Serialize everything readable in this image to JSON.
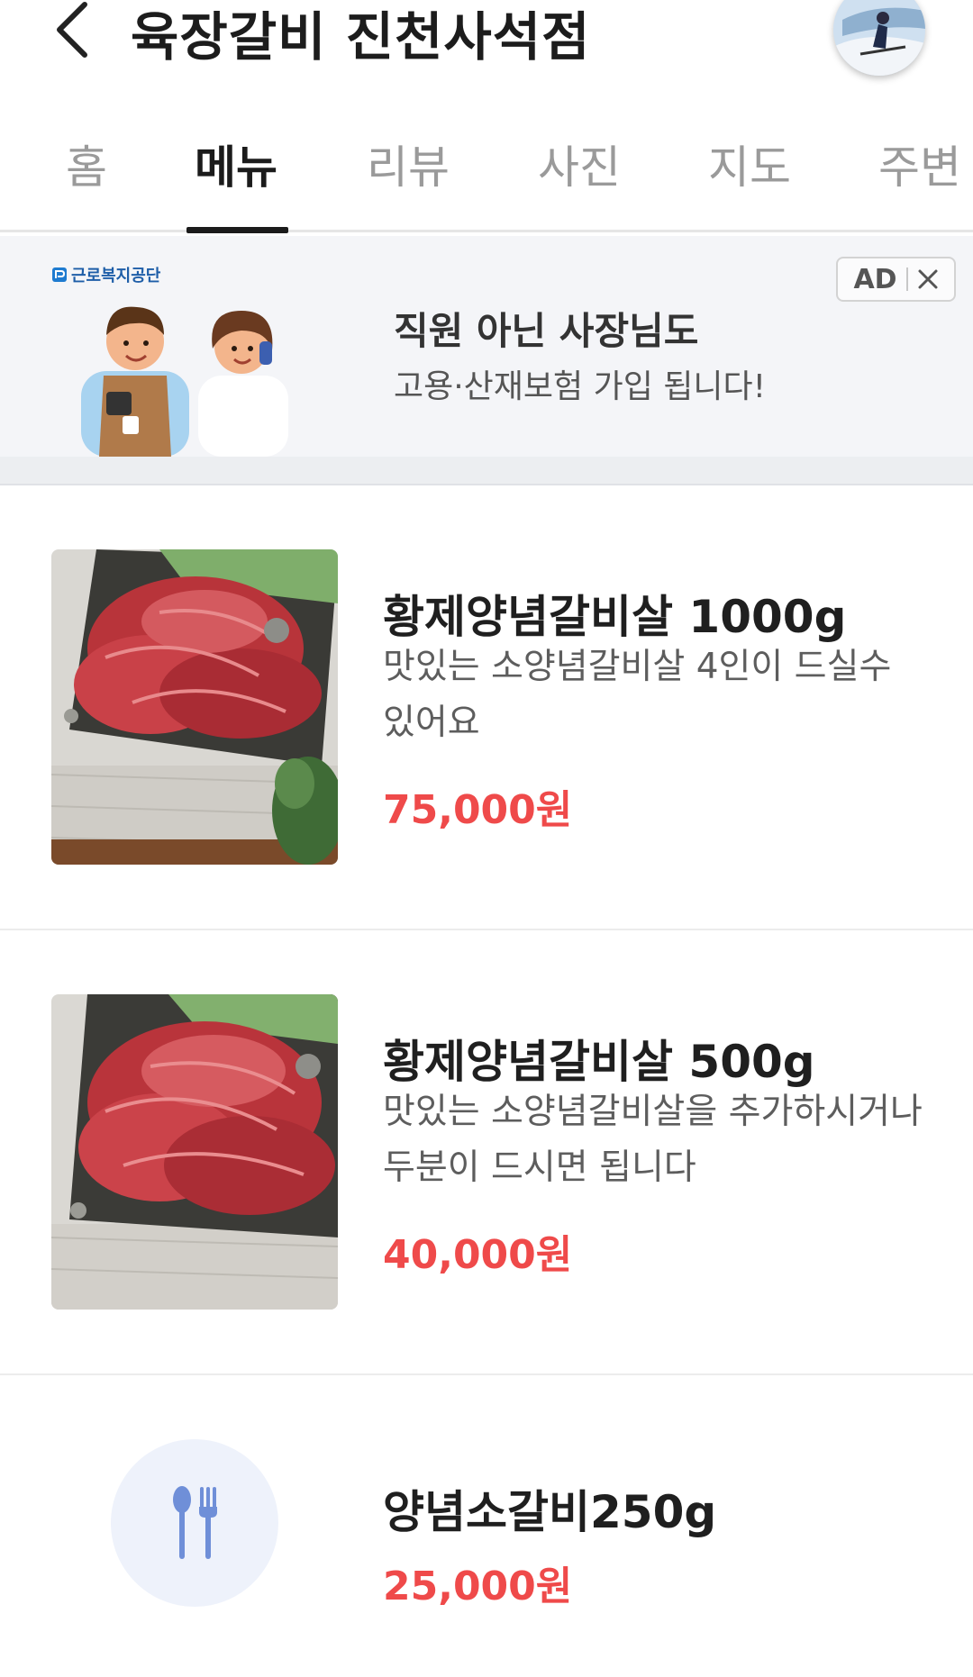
{
  "header": {
    "title": "육장갈비 진천사석점"
  },
  "tabs": [
    {
      "label": "홈",
      "active": false
    },
    {
      "label": "메뉴",
      "active": true
    },
    {
      "label": "리뷰",
      "active": false
    },
    {
      "label": "사진",
      "active": false
    },
    {
      "label": "지도",
      "active": false
    },
    {
      "label": "주변",
      "active": false
    }
  ],
  "ad": {
    "brand": "근로복지공단",
    "title": "직원 아닌 사장님도",
    "subtitle": "고용·산재보험 가입 됩니다!",
    "badge": "AD"
  },
  "menu": [
    {
      "name": "황제양념갈비살 1000g",
      "description": "맛있는 소양념갈비살 4인이 드실수 있어요",
      "price": "75,000원",
      "image": "marinated-beef-photo"
    },
    {
      "name": "황제양념갈비살 500g",
      "description": "맛있는 소양념갈비살을 추가하시거나 두분이 드시면 됩니다",
      "price": "40,000원",
      "image": "marinated-beef-photo"
    },
    {
      "name": "양념소갈비250g",
      "description": "",
      "price": "25,000원",
      "image": "utensils-icon"
    }
  ],
  "colors": {
    "price": "#ef4a4a",
    "active_tab": "#1b1b1b",
    "inactive_tab": "#9a9a9a",
    "ad_background": "#f4f5f8",
    "placeholder_icon": "#6f8fd8"
  }
}
